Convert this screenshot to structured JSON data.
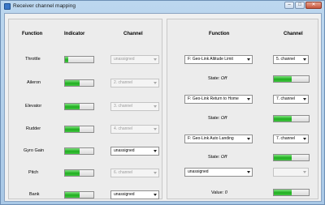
{
  "window": {
    "title": "Receiver channel mapping"
  },
  "left": {
    "headers": {
      "function": "Function",
      "indicator": "Indicator",
      "channel": "Channel"
    },
    "rows": [
      {
        "label": "Throttle",
        "level": 0.1,
        "channel": "unassigned",
        "enabled": false
      },
      {
        "label": "Aileron",
        "level": 0.5,
        "channel": "2. channel",
        "enabled": false
      },
      {
        "label": "Elevator",
        "level": 0.5,
        "channel": "3. channel",
        "enabled": false
      },
      {
        "label": "Rudder",
        "level": 0.5,
        "channel": "4. channel",
        "enabled": false
      },
      {
        "label": "Gyro Gain",
        "level": 0.5,
        "channel": "unassigned",
        "enabled": true
      },
      {
        "label": "Pitch",
        "level": 0.5,
        "channel": "6. channel",
        "enabled": false
      },
      {
        "label": "Bank",
        "level": 0.5,
        "channel": "unassigned",
        "enabled": true
      }
    ]
  },
  "right": {
    "headers": {
      "function": "Function",
      "channel": "Channel"
    },
    "groups": [
      {
        "function": "F: Geo-Link Altitude Limit",
        "channel": "5. channel",
        "channel_enabled": true,
        "state_label": "State:",
        "state_value": "Off",
        "level": 0.5
      },
      {
        "function": "F: Geo-Link Return to Home",
        "channel": "7. channel",
        "channel_enabled": true,
        "state_label": "State:",
        "state_value": "Off",
        "level": 0.5
      },
      {
        "function": "F: Geo-Link Auto Landing",
        "channel": "7. channel",
        "channel_enabled": true,
        "state_label": "State:",
        "state_value": "Off",
        "level": 0.5
      },
      {
        "function": "unassigned",
        "channel": "",
        "channel_enabled": false,
        "state_label": "Value:",
        "state_value": "0",
        "level": 0.5
      }
    ]
  },
  "colors": {
    "indicator_fill": "#1fae1f",
    "title_bar": "#bcd7ef"
  }
}
